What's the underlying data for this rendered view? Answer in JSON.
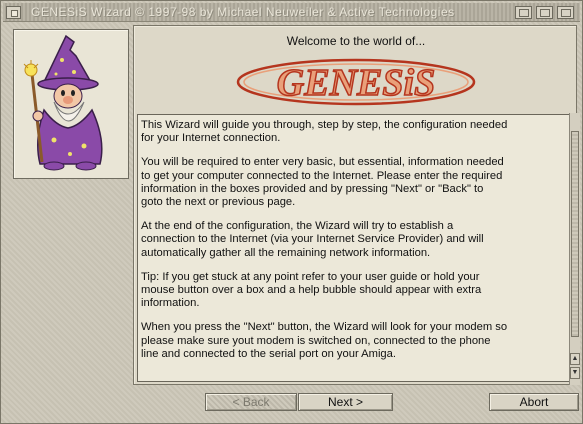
{
  "window": {
    "title": "GENESiS Wizard © 1997-98 by Michael Neuweiler & Active Technologies"
  },
  "header": {
    "welcome": "Welcome to the world of...",
    "logo_text": "GENESiS"
  },
  "content": {
    "paragraphs": [
      "This Wizard will guide you through, step by step, the configuration needed\nfor your Internet connection.",
      "You will be required to enter very basic, but essential, information needed\nto get your computer connected to the Internet. Please enter the required\ninformation in the boxes provided and by pressing \"Next\" or \"Back\" to\ngoto the next or previous page.",
      "At the end of the configuration, the Wizard will try to establish a\nconnection to the Internet (via your Internet Service Provider) and will\nautomatically gather all the remaining network information.",
      "Tip: If you get stuck at any point refer to your user guide or hold your\nmouse button over a box and a help bubble should appear with extra\ninformation.",
      "When you press the \"Next\" button, the Wizard will look for your modem so\nplease make sure yout modem is switched on, connected to the phone\nline and connected to the serial port on your Amiga."
    ]
  },
  "buttons": {
    "back": "< Back",
    "next": "Next >",
    "abort": "Abort"
  },
  "colors": {
    "logo_fill": "#e9a07a",
    "logo_outline": "#b5351e",
    "wizard_robe": "#8a4aa8",
    "panel_bg": "#ece8d9"
  }
}
